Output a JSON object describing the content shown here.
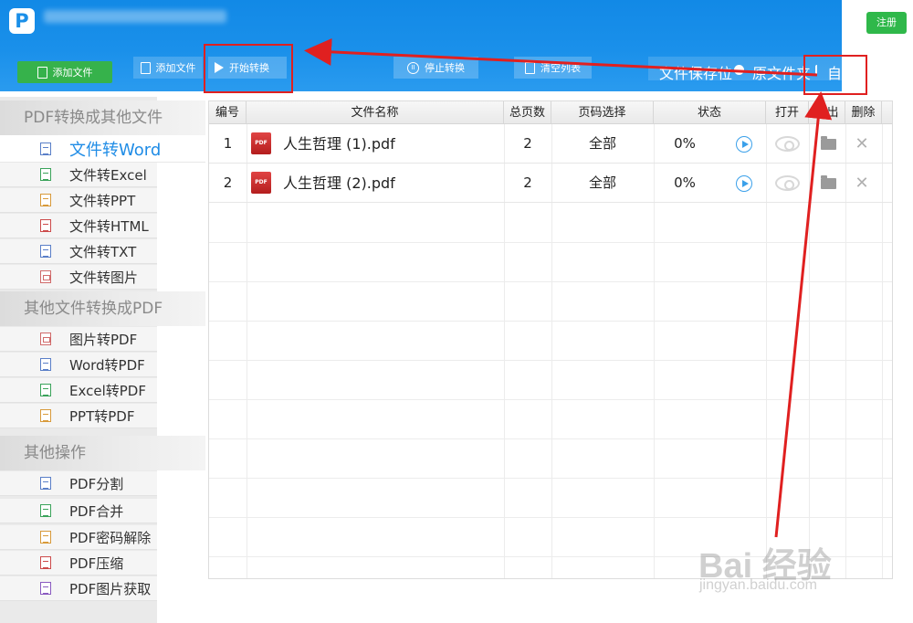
{
  "header": {
    "logo_letter": "P",
    "register_label": "注册",
    "add_file_label": "添加文件",
    "add_file2_label": "添加文件",
    "start_label": "开始转换",
    "stop_label": "停止转换",
    "clear_label": "清空列表",
    "save_location_label": "文件保存位",
    "option_original": "原文件夹",
    "option_custom": "自定义"
  },
  "sidebar": {
    "section1": "PDF转换成其他文件",
    "section2": "其他文件转换成PDF",
    "section3": "其他操作",
    "items": [
      {
        "label": "文件转Word"
      },
      {
        "label": "文件转Excel"
      },
      {
        "label": "文件转PPT"
      },
      {
        "label": "文件转HTML"
      },
      {
        "label": "文件转TXT"
      },
      {
        "label": "文件转图片"
      },
      {
        "label": "图片转PDF"
      },
      {
        "label": "Word转PDF"
      },
      {
        "label": "Excel转PDF"
      },
      {
        "label": "PPT转PDF"
      },
      {
        "label": "PDF分割"
      },
      {
        "label": "PDF合并"
      },
      {
        "label": "PDF密码解除"
      },
      {
        "label": "PDF压缩"
      },
      {
        "label": "PDF图片获取"
      }
    ]
  },
  "table": {
    "headers": [
      "编号",
      "文件名称",
      "总页数",
      "页码选择",
      "状态",
      "打开",
      "输出",
      "删除"
    ],
    "rows": [
      {
        "no": "1",
        "name": "人生哲理 (1).pdf",
        "pages": "2",
        "range": "全部",
        "status": "0%"
      },
      {
        "no": "2",
        "name": "人生哲理 (2).pdf",
        "pages": "2",
        "range": "全部",
        "status": "0%"
      }
    ],
    "pdf_icon_text": "PDF",
    "delete_glyph": "✕"
  },
  "watermark": {
    "main": "Bai 经验",
    "sub": "jingyan.baidu.com"
  },
  "colors": {
    "header_blue": "#1a90ea",
    "green": "#36b24b",
    "active_blue": "#1f8ce6",
    "annotation_red": "#e02020"
  }
}
